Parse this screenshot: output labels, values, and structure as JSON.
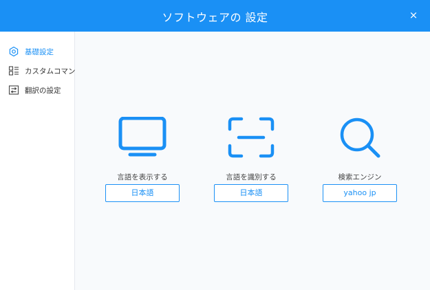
{
  "window": {
    "title": "ソフトウェアの 設定",
    "close_label": "×"
  },
  "sidebar": {
    "items": [
      {
        "label": "基礎設定",
        "icon": "gear-icon",
        "active": true
      },
      {
        "label": "カスタムコマンド",
        "icon": "list-icon",
        "active": false
      },
      {
        "label": "翻訳の設定",
        "icon": "translate-icon",
        "active": false
      }
    ]
  },
  "main": {
    "columns": [
      {
        "label": "言語を表示する",
        "button": "日本語",
        "icon": "monitor-icon"
      },
      {
        "label": "言語を識別する",
        "button": "日本語",
        "icon": "scan-icon"
      },
      {
        "label": "検索エンジン",
        "button": "yahoo jp",
        "icon": "search-icon"
      }
    ]
  },
  "colors": {
    "accent": "#1a90f5",
    "content_background": "#f8fafc",
    "text": "#333333"
  }
}
